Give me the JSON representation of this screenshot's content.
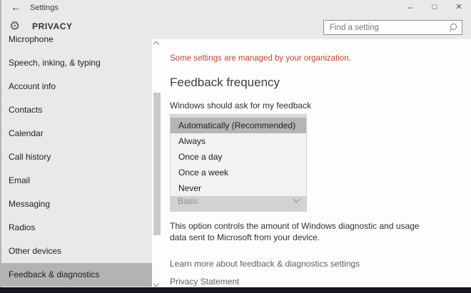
{
  "colors": {
    "window_chrome": "#e9e9e9",
    "content_background": "#fdfdfd",
    "selected_highlight": "#b3b3b3",
    "notice_text": "#c0452c",
    "bottom_bar": "#16161e"
  },
  "titlebar": {
    "title": "Settings",
    "back_icon": "←",
    "minimize_icon": "–",
    "maximize_icon": "□",
    "close_icon": "×"
  },
  "header": {
    "title": "PRIVACY",
    "gear_icon": "⚙",
    "search_placeholder": "Find a setting"
  },
  "sidebar": {
    "items": [
      {
        "label": "Microphone",
        "selected": false
      },
      {
        "label": "Speech, inking, & typing",
        "selected": false
      },
      {
        "label": "Account info",
        "selected": false
      },
      {
        "label": "Contacts",
        "selected": false
      },
      {
        "label": "Calendar",
        "selected": false
      },
      {
        "label": "Call history",
        "selected": false
      },
      {
        "label": "Email",
        "selected": false
      },
      {
        "label": "Messaging",
        "selected": false
      },
      {
        "label": "Radios",
        "selected": false
      },
      {
        "label": "Other devices",
        "selected": false
      },
      {
        "label": "Feedback & diagnostics",
        "selected": true
      }
    ]
  },
  "main": {
    "notice": "Some settings are managed by your organization.",
    "heading": "Feedback frequency",
    "feedback_dropdown": {
      "label": "Windows should ask for my feedback",
      "options": [
        "Automatically (Recommended)",
        "Always",
        "Once a day",
        "Once a week",
        "Never"
      ],
      "selected_option": "Automatically (Recommended)"
    },
    "diagnostic_dropdown": {
      "selected_option": "Basic"
    },
    "description": {
      "line1": "This option controls the amount of Windows diagnostic and usage",
      "line2": "data sent to Microsoft from your device."
    },
    "links": [
      {
        "label": "Learn more about feedback & diagnostics settings"
      },
      {
        "label": "Privacy Statement"
      }
    ]
  }
}
